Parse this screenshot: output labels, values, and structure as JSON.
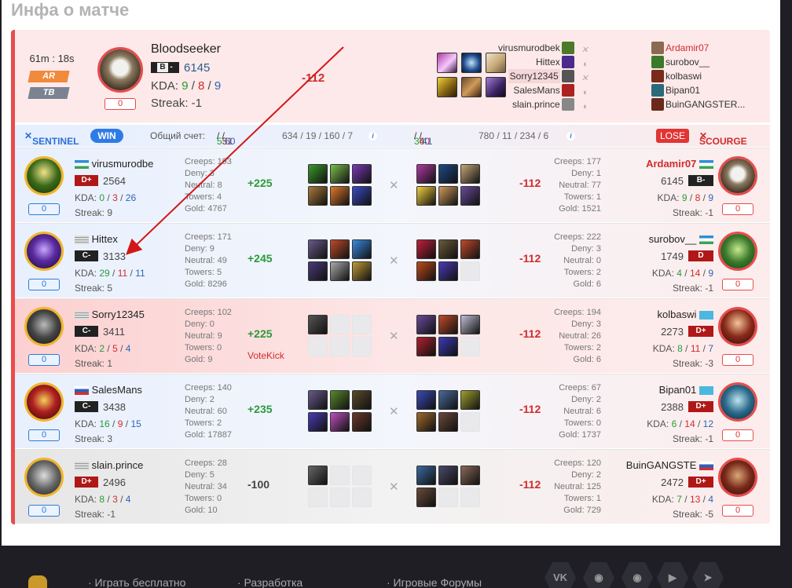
{
  "page_title": "Инфа о матче",
  "match": {
    "duration": "61m : 18s",
    "mode_ar": "AR",
    "mode_tb": "TB",
    "best_hero_name": "Bloodseeker",
    "best_rank_letter": "B",
    "best_rank_sign": "-",
    "best_rating": "6145",
    "kda_label": "KDA:",
    "best_k": "9",
    "best_d": "8",
    "best_a": "9",
    "streak_label": "Streak: -1",
    "best_pill": "0",
    "best_delta": "-112"
  },
  "overview_left": [
    "virusmurodbek",
    "Hittex",
    "Sorry12345",
    "SalesMans",
    "slain.prince"
  ],
  "overview_right": [
    "Ardamir07",
    "surobov__",
    "kolbaswi",
    "Bipan01",
    "BuinGANGSTER..."
  ],
  "team_header": {
    "sentinel": "SENTINEL",
    "win": "WIN",
    "score_label": "Общий счет:",
    "score_a": "55",
    "score_b": "31",
    "score_c": "60",
    "sent_stats": "634 / 19 / 160 / 7",
    "info_icon": "i",
    "scourge_a": "34",
    "scourge_b": "60",
    "scourge_c": "41",
    "scourge_stats": "780 / 11 / 234 / 6",
    "lose": "LOSE",
    "scourge": "SCOURGE"
  },
  "rows": [
    {
      "l_name": "virusmurodbe",
      "l_rank": "D+",
      "l_rating": "2564",
      "l_k": "0",
      "l_d": "3",
      "l_a": "26",
      "l_streak": "Streak: 9",
      "l_pill": "0",
      "l_stats": [
        "Creeps: 193",
        "Deny: 3",
        "Neutral: 8",
        "Towers: 4",
        "Gold: 4767"
      ],
      "l_delta": "+225",
      "l_extra": "",
      "r_stats": [
        "Creeps: 177",
        "Deny: 1",
        "Neutral: 77",
        "Towers: 1",
        "Gold: 1521"
      ],
      "r_delta": "-112",
      "r_name": "Ardamir07",
      "r_rank": "B-",
      "r_rating": "6145",
      "r_k": "9",
      "r_d": "8",
      "r_a": "9",
      "r_streak": "Streak: -1",
      "r_pill": "0"
    },
    {
      "l_name": "Hittex",
      "l_rank": "C-",
      "l_rating": "3133",
      "l_k": "29",
      "l_d": "11",
      "l_a": "11",
      "l_streak": "Streak: 5",
      "l_pill": "0",
      "l_stats": [
        "Creeps: 171",
        "Deny: 9",
        "Neutral: 49",
        "Towers: 5",
        "Gold: 8296"
      ],
      "l_delta": "+245",
      "l_extra": "",
      "r_stats": [
        "Creeps: 222",
        "Deny: 3",
        "Neutral: 0",
        "Towers: 2",
        "Gold: 6"
      ],
      "r_delta": "-112",
      "r_name": "surobov__",
      "r_rank": "D",
      "r_rating": "1749",
      "r_k": "4",
      "r_d": "14",
      "r_a": "9",
      "r_streak": "Streak: -1",
      "r_pill": "0"
    },
    {
      "l_name": "Sorry12345",
      "l_rank": "C-",
      "l_rating": "3411",
      "l_k": "2",
      "l_d": "5",
      "l_a": "4",
      "l_streak": "Streak: 1",
      "l_pill": "0",
      "l_stats": [
        "Creeps: 102",
        "Deny: 0",
        "Neutral: 9",
        "Towers: 0",
        "Gold: 9"
      ],
      "l_delta": "+225",
      "l_extra": "VoteKick",
      "r_stats": [
        "Creeps: 194",
        "Deny: 3",
        "Neutral: 26",
        "Towers: 2",
        "Gold: 6"
      ],
      "r_delta": "-112",
      "r_name": "kolbaswi",
      "r_rank": "D+",
      "r_rating": "2273",
      "r_k": "8",
      "r_d": "11",
      "r_a": "7",
      "r_streak": "Streak: -3",
      "r_pill": "0"
    },
    {
      "l_name": "SalesMans",
      "l_rank": "C-",
      "l_rating": "3438",
      "l_k": "16",
      "l_d": "9",
      "l_a": "15",
      "l_streak": "Streak: 3",
      "l_pill": "0",
      "l_stats": [
        "Creeps: 140",
        "Deny: 2",
        "Neutral: 60",
        "Towers: 2",
        "Gold: 17887"
      ],
      "l_delta": "+235",
      "l_extra": "",
      "r_stats": [
        "Creeps: 67",
        "Deny: 2",
        "Neutral: 6",
        "Towers: 0",
        "Gold: 1737"
      ],
      "r_delta": "-112",
      "r_name": "Bipan01",
      "r_rank": "D+",
      "r_rating": "2388",
      "r_k": "6",
      "r_d": "14",
      "r_a": "12",
      "r_streak": "Streak: -1",
      "r_pill": "0"
    },
    {
      "l_name": "slain.prince",
      "l_rank": "D+",
      "l_rating": "2496",
      "l_k": "8",
      "l_d": "3",
      "l_a": "4",
      "l_streak": "Streak: -1",
      "l_pill": "0",
      "l_stats": [
        "Creeps: 28",
        "Deny: 5",
        "Neutral: 34",
        "Towers: 0",
        "Gold: 10"
      ],
      "l_delta": "-100",
      "l_extra": "",
      "r_stats": [
        "Creeps: 120",
        "Deny: 2",
        "Neutral: 125",
        "Towers: 1",
        "Gold: 729"
      ],
      "r_delta": "-112",
      "r_name": "BuinGANGSTE",
      "r_rank": "D+",
      "r_rating": "2472",
      "r_k": "7",
      "r_d": "13",
      "r_a": "4",
      "r_streak": "Streak: -5",
      "r_pill": "0"
    }
  ],
  "footer": {
    "play": "· Играть бесплатно",
    "dev": "· Разработка",
    "forums": "· Игровые Форумы",
    "vk": "VK"
  }
}
